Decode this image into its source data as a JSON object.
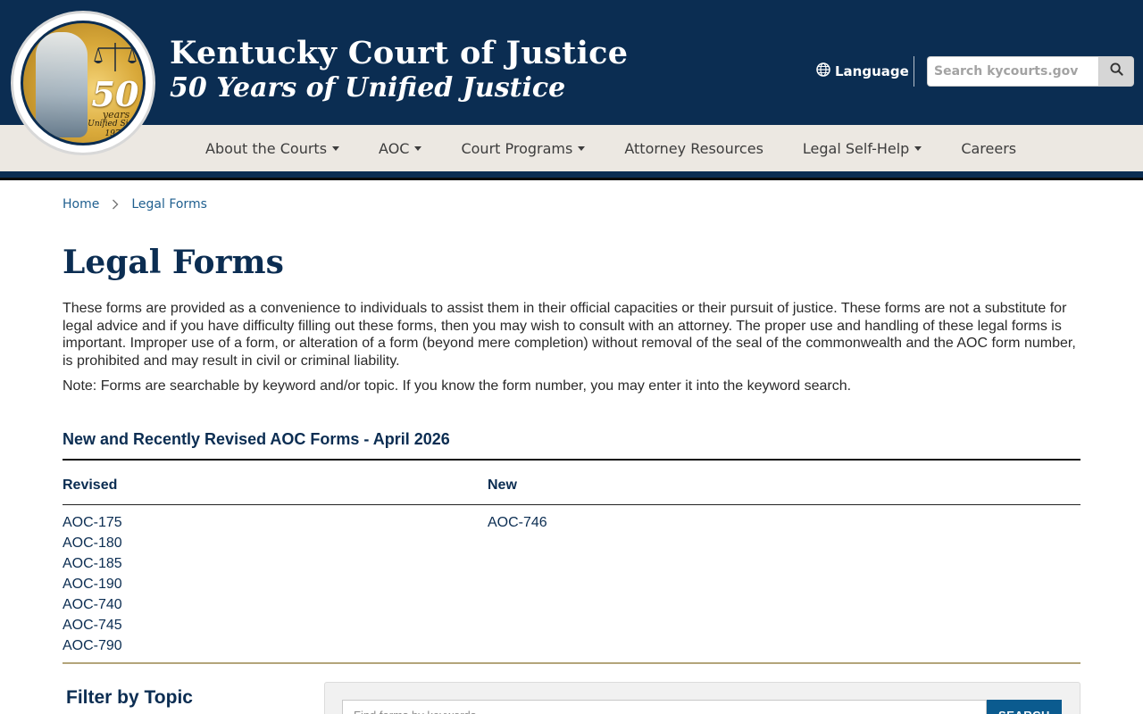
{
  "header": {
    "title": "Kentucky Court of Justice",
    "subtitle": "50 Years of Unified Justice",
    "seal": {
      "number": "50",
      "years": "years",
      "since": "Unified Since 1976",
      "ring_text": "KENTUCKY COURT OF JUSTICE"
    },
    "language_label": "Language",
    "search_placeholder": "Search kycourts.gov"
  },
  "nav": {
    "items": [
      {
        "label": "About the Courts",
        "dropdown": true
      },
      {
        "label": "AOC",
        "dropdown": true
      },
      {
        "label": "Court Programs",
        "dropdown": true
      },
      {
        "label": "Attorney Resources",
        "dropdown": false
      },
      {
        "label": "Legal Self-Help",
        "dropdown": true
      },
      {
        "label": "Careers",
        "dropdown": false
      }
    ]
  },
  "breadcrumb": {
    "home": "Home",
    "current": "Legal Forms"
  },
  "page": {
    "title": "Legal Forms",
    "intro": "These forms are provided as a convenience to individuals to assist them in their official capacities or their pursuit of justice. These forms are not a substitute for legal advice and if you have difficulty filling out these forms, then you may wish to consult with an attorney. The proper use and handling of these legal forms is important. Improper use of a form, or alteration of a form (beyond mere completion) without removal of the seal of the commonwealth and the AOC form number, is prohibited and may result in civil or criminal liability.",
    "note": "Note: Forms are searchable by keyword and/or topic. If you know the form number, you may enter it into the keyword search."
  },
  "recent_forms": {
    "title": "New and Recently Revised AOC Forms - April 2026",
    "revised_header": "Revised",
    "new_header": "New",
    "revised": [
      "AOC-175",
      "AOC-180",
      "AOC-185",
      "AOC-190",
      "AOC-740",
      "AOC-745",
      "AOC-790"
    ],
    "new": [
      "AOC-746"
    ]
  },
  "filter": {
    "title": "Filter by Topic",
    "keyword_placeholder": "Find forms by keywords",
    "search_button": "SEARCH"
  },
  "colors": {
    "navy": "#0b2d52",
    "nav_bg": "#ece8e2",
    "link": "#1f5f8f",
    "gold_rule": "#b3a57a",
    "button_blue": "#0b5b8f"
  }
}
